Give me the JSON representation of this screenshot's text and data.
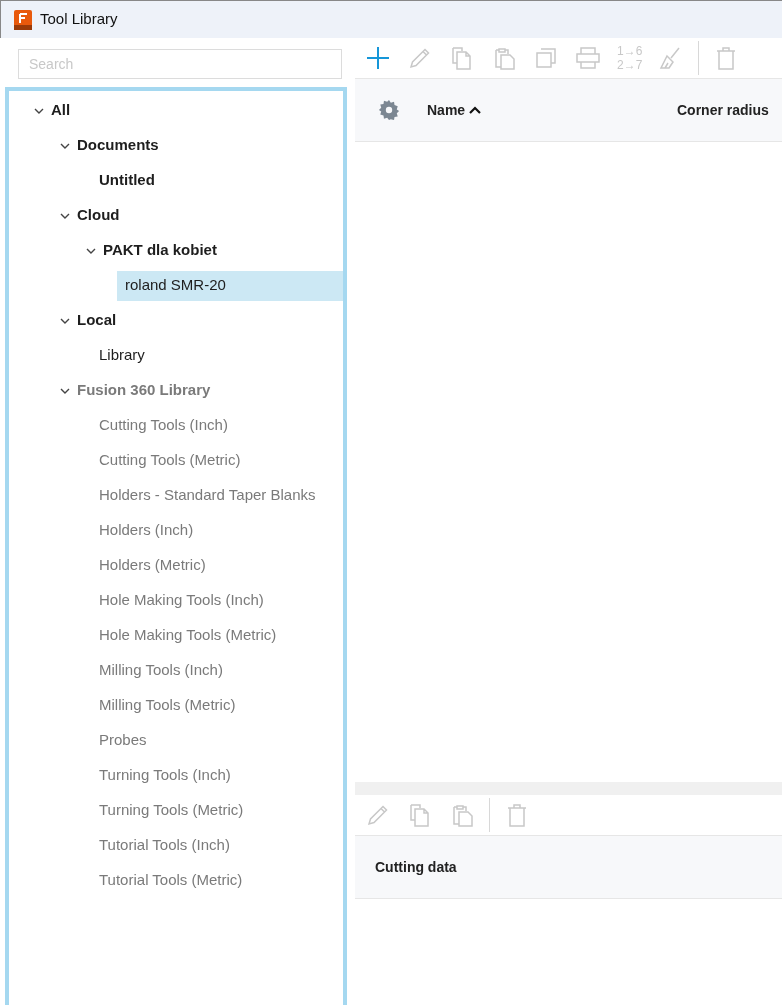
{
  "window": {
    "title": "Tool Library"
  },
  "search": {
    "placeholder": "Search"
  },
  "tree": [
    {
      "label": "All",
      "bold": true,
      "expanded": true,
      "selected": false,
      "children": [
        {
          "label": "Documents",
          "bold": true,
          "expanded": true,
          "selected": false,
          "children": [
            {
              "label": "Untitled",
              "bold": true,
              "selected": false
            }
          ]
        },
        {
          "label": "Cloud",
          "bold": true,
          "expanded": true,
          "selected": false,
          "children": [
            {
              "label": "PAKT dla kobiet",
              "bold": true,
              "expanded": true,
              "selected": false,
              "children": [
                {
                  "label": "roland SMR-20",
                  "bold": false,
                  "selected": true
                }
              ]
            }
          ]
        },
        {
          "label": "Local",
          "bold": true,
          "expanded": true,
          "selected": false,
          "children": [
            {
              "label": "Library",
              "bold": false,
              "selected": false
            }
          ]
        },
        {
          "label": "Fusion 360 Library",
          "bold": true,
          "disabled": true,
          "expanded": true,
          "selected": false,
          "children": [
            {
              "label": "Cutting Tools (Inch)",
              "bold": false,
              "disabled": true,
              "selected": false
            },
            {
              "label": "Cutting Tools (Metric)",
              "bold": false,
              "disabled": true,
              "selected": false
            },
            {
              "label": "Holders - Standard Taper Blanks",
              "bold": false,
              "disabled": true,
              "selected": false
            },
            {
              "label": "Holders (Inch)",
              "bold": false,
              "disabled": true,
              "selected": false
            },
            {
              "label": "Holders (Metric)",
              "bold": false,
              "disabled": true,
              "selected": false
            },
            {
              "label": "Hole Making Tools (Inch)",
              "bold": false,
              "disabled": true,
              "selected": false
            },
            {
              "label": "Hole Making Tools (Metric)",
              "bold": false,
              "disabled": true,
              "selected": false
            },
            {
              "label": "Milling Tools (Inch)",
              "bold": false,
              "disabled": true,
              "selected": false
            },
            {
              "label": "Milling Tools (Metric)",
              "bold": false,
              "disabled": true,
              "selected": false
            },
            {
              "label": "Probes",
              "bold": false,
              "disabled": true,
              "selected": false
            },
            {
              "label": "Turning Tools (Inch)",
              "bold": false,
              "disabled": true,
              "selected": false
            },
            {
              "label": "Turning Tools (Metric)",
              "bold": false,
              "disabled": true,
              "selected": false
            },
            {
              "label": "Tutorial Tools (Inch)",
              "bold": false,
              "disabled": true,
              "selected": false
            },
            {
              "label": "Tutorial Tools (Metric)",
              "bold": false,
              "disabled": true,
              "selected": false
            }
          ]
        }
      ]
    }
  ],
  "toolbar": [
    {
      "kind": "add",
      "disabled": false
    },
    {
      "kind": "edit",
      "disabled": true
    },
    {
      "kind": "copy",
      "disabled": true
    },
    {
      "kind": "paste",
      "disabled": true
    },
    {
      "kind": "duplicate",
      "disabled": true
    },
    {
      "kind": "print",
      "disabled": true
    },
    {
      "kind": "renumber",
      "disabled": true,
      "lines": [
        "1→6",
        "2→7"
      ]
    },
    {
      "kind": "clean",
      "disabled": true
    },
    {
      "kind": "separator"
    },
    {
      "kind": "delete",
      "disabled": true
    }
  ],
  "table": {
    "columns": [
      {
        "kind": "settings"
      },
      {
        "kind": "text",
        "label": "Name",
        "sorted": true
      },
      {
        "kind": "text",
        "label": "Corner radius"
      }
    ]
  },
  "detail": {
    "toolbar": [
      {
        "kind": "edit",
        "disabled": true
      },
      {
        "kind": "copy",
        "disabled": true
      },
      {
        "kind": "paste",
        "disabled": true
      },
      {
        "kind": "separator"
      },
      {
        "kind": "delete",
        "disabled": true
      }
    ],
    "header": "Cutting data"
  }
}
